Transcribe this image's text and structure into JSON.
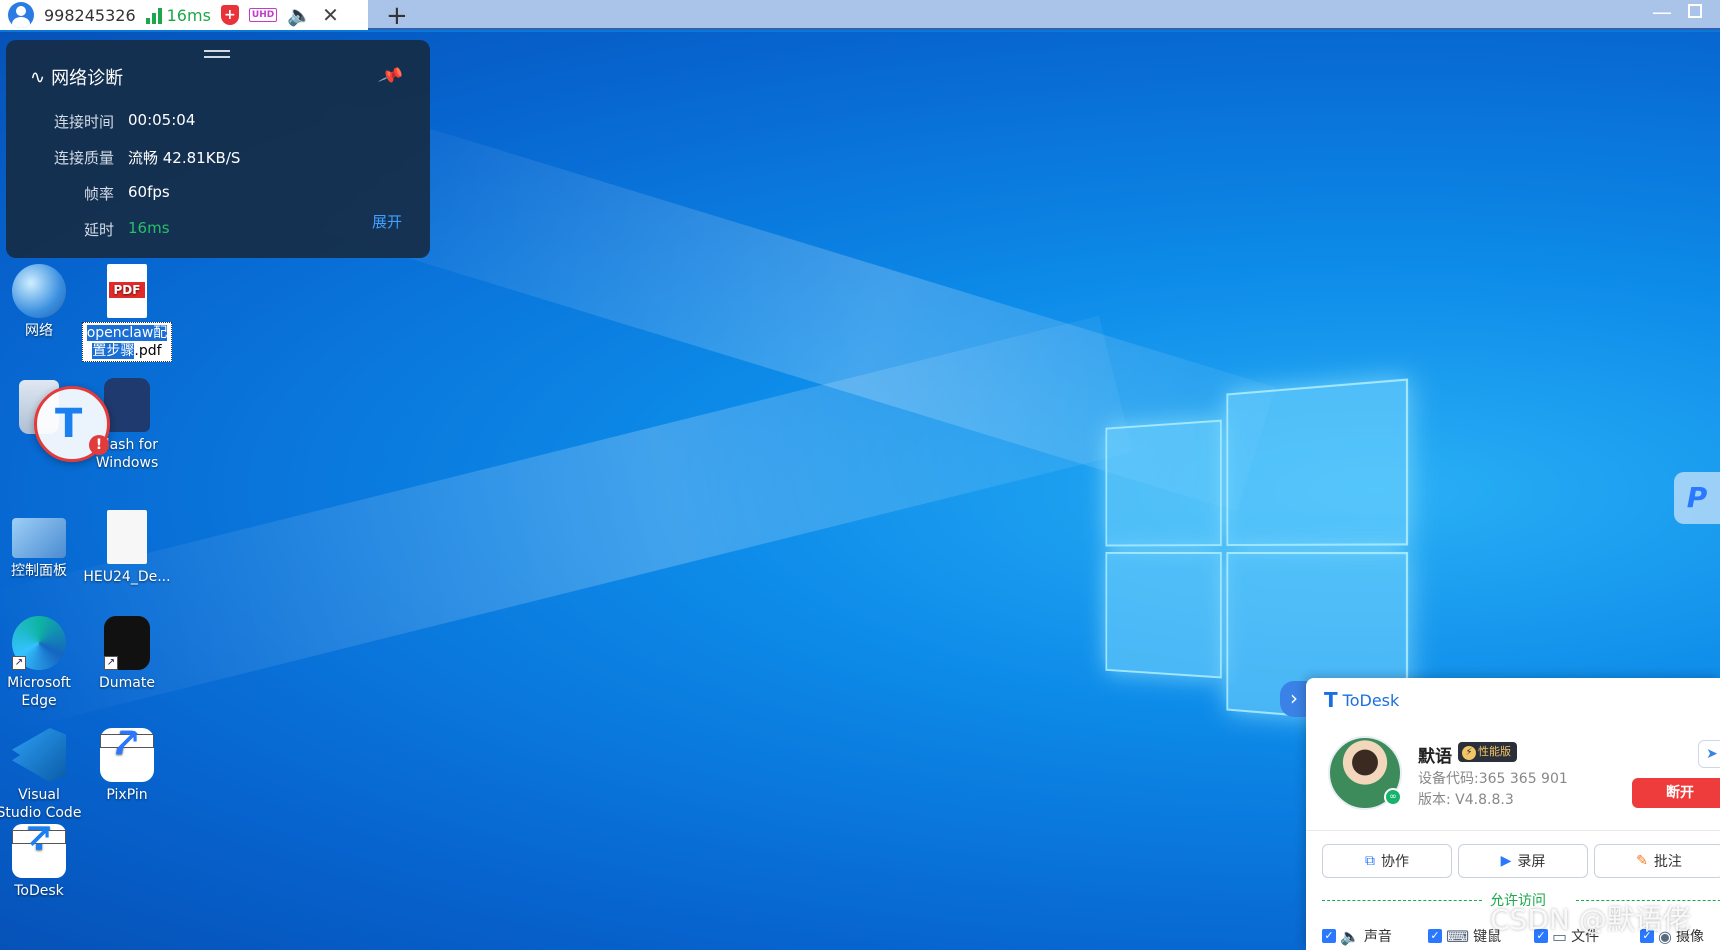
{
  "tab": {
    "device_id": "998245326",
    "latency": "16ms",
    "uhd": "UHD",
    "new_tab": "+",
    "close": "✕",
    "shield": "+"
  },
  "window": {
    "minimize": "—"
  },
  "diagnostics": {
    "title": "网络诊断",
    "rows": [
      {
        "label": "连接时间",
        "value": "00:05:04"
      },
      {
        "label": "连接质量",
        "value": "流畅 42.81KB/S"
      },
      {
        "label": "帧率",
        "value": "60fps"
      },
      {
        "label": "延时",
        "value": "16ms"
      }
    ],
    "expand": "展开"
  },
  "desktop_icons": {
    "network": "网络",
    "pdf_badge": "PDF",
    "pdf_file_hl": "openclaw配置步骤",
    "pdf_file_rest": ".pdf",
    "clash": "Clash for Windows",
    "control_panel": "控制面板",
    "heu": "HEU24_De...",
    "edge": "Microsoft Edge",
    "dumate": "Dumate",
    "vscode": "Visual Studio Code",
    "pixpin": "PixPin",
    "todesk": "ToDesk"
  },
  "todesk_panel": {
    "brand": "ToDesk",
    "username": "默语",
    "edition": "性能版",
    "device_code": "设备代码:365 365 901",
    "version": "版本: V4.8.8.3",
    "disconnect": "断开",
    "buttons": [
      "协作",
      "录屏",
      "批注"
    ],
    "allow_access": "允许访问",
    "permissions": [
      "声音",
      "键鼠",
      "文件",
      "摄像"
    ]
  },
  "watermark": "CSDN @默语佬",
  "colors": {
    "accent": "#1b7ff0",
    "danger": "#ee3b3b",
    "ok": "#1aa84a"
  }
}
